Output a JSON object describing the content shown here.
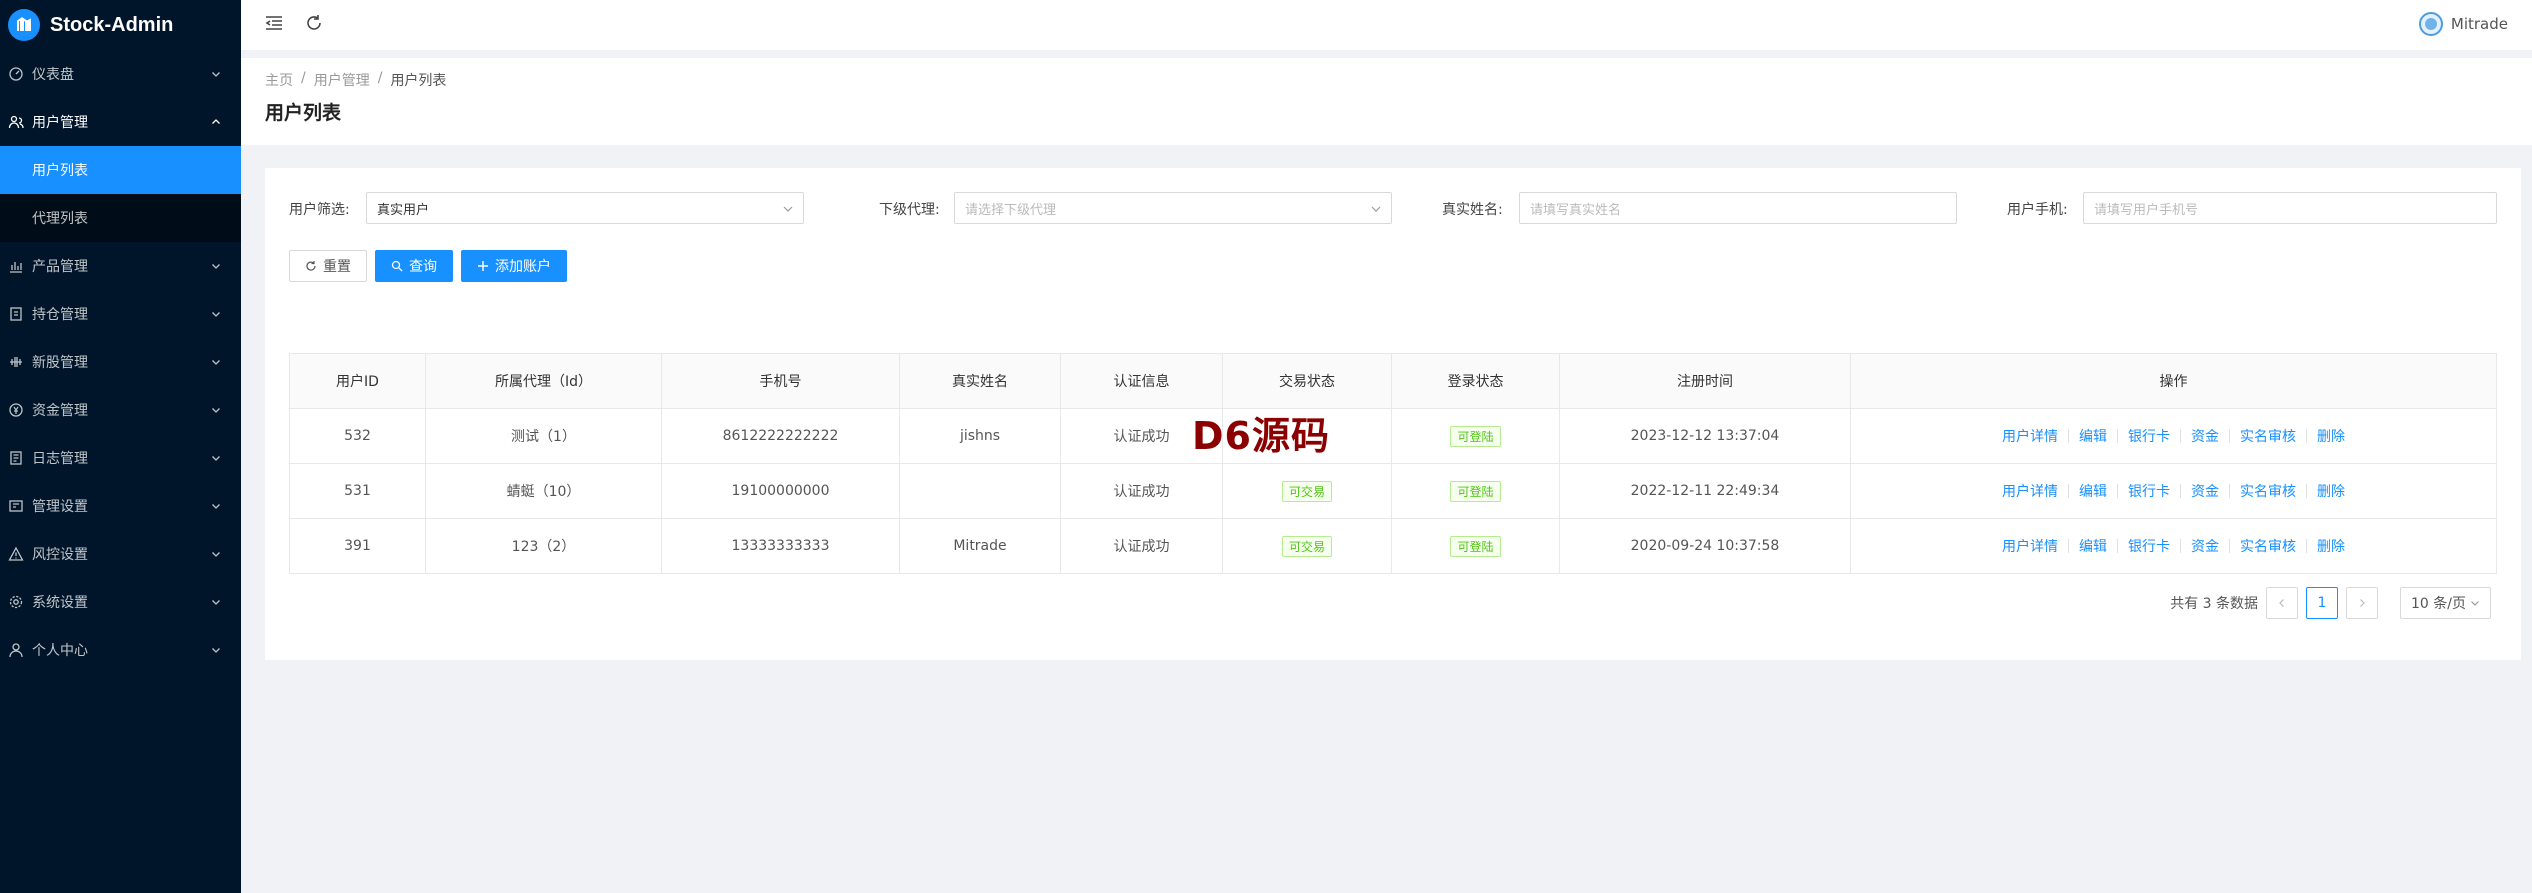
{
  "app": {
    "title": "Stock-Admin"
  },
  "sidebar": {
    "menus": [
      {
        "label": "仪表盘",
        "icon": "dashboard-icon",
        "open": false
      },
      {
        "label": "用户管理",
        "icon": "user-group-icon",
        "open": true
      },
      {
        "label": "产品管理",
        "icon": "bar-chart-icon",
        "open": false
      },
      {
        "label": "持仓管理",
        "icon": "holding-icon",
        "open": false
      },
      {
        "label": "新股管理",
        "icon": "ipo-icon",
        "open": false
      },
      {
        "label": "资金管理",
        "icon": "money-icon",
        "open": false
      },
      {
        "label": "日志管理",
        "icon": "log-icon",
        "open": false
      },
      {
        "label": "管理设置",
        "icon": "admin-settings-icon",
        "open": false
      },
      {
        "label": "风控设置",
        "icon": "warning-icon",
        "open": false
      },
      {
        "label": "系统设置",
        "icon": "gear-icon",
        "open": false
      },
      {
        "label": "个人中心",
        "icon": "user-icon",
        "open": false
      }
    ],
    "user_submenu": [
      {
        "label": "用户列表",
        "active": true
      },
      {
        "label": "代理列表",
        "active": false
      }
    ]
  },
  "header": {
    "username": "Mitrade"
  },
  "breadcrumb": [
    "主页",
    "用户管理",
    "用户列表"
  ],
  "page_title": "用户列表",
  "filters": {
    "user_filter": {
      "label": "用户筛选:",
      "value": "真实用户"
    },
    "agent": {
      "label": "下级代理:",
      "placeholder": "请选择下级代理"
    },
    "real_name": {
      "label": "真实姓名:",
      "placeholder": "请填写真实姓名"
    },
    "phone": {
      "label": "用户手机:",
      "placeholder": "请填写用户手机号"
    }
  },
  "buttons": {
    "reset": "重置",
    "search": "查询",
    "add": "添加账户"
  },
  "table": {
    "columns": [
      "用户ID",
      "所属代理（Id）",
      "手机号",
      "真实姓名",
      "认证信息",
      "交易状态",
      "登录状态",
      "注册时间",
      "操作"
    ],
    "rows": [
      {
        "id": "532",
        "agent": "测试（1）",
        "phone": "8612222222222",
        "name": "jishns",
        "auth": "认证成功",
        "trade": "",
        "login": "可登陆",
        "time": "2023-12-12 13:37:04"
      },
      {
        "id": "531",
        "agent": "蜻蜓（10）",
        "phone": "19100000000",
        "name": "",
        "auth": "认证成功",
        "trade": "可交易",
        "login": "可登陆",
        "time": "2022-12-11 22:49:34"
      },
      {
        "id": "391",
        "agent": "123（2）",
        "phone": "13333333333",
        "name": "Mitrade",
        "auth": "认证成功",
        "trade": "可交易",
        "login": "可登陆",
        "time": "2020-09-24 10:37:58"
      }
    ],
    "actions": [
      "用户详情",
      "编辑",
      "银行卡",
      "资金",
      "实名审核",
      "删除"
    ]
  },
  "pagination": {
    "total_text": "共有 3 条数据",
    "current": "1",
    "page_size": "10 条/页"
  },
  "watermark": "D6源码",
  "colors": {
    "sidebar_bg": "#001529",
    "primary": "#1890ff",
    "tag_green": "#52c41a"
  }
}
